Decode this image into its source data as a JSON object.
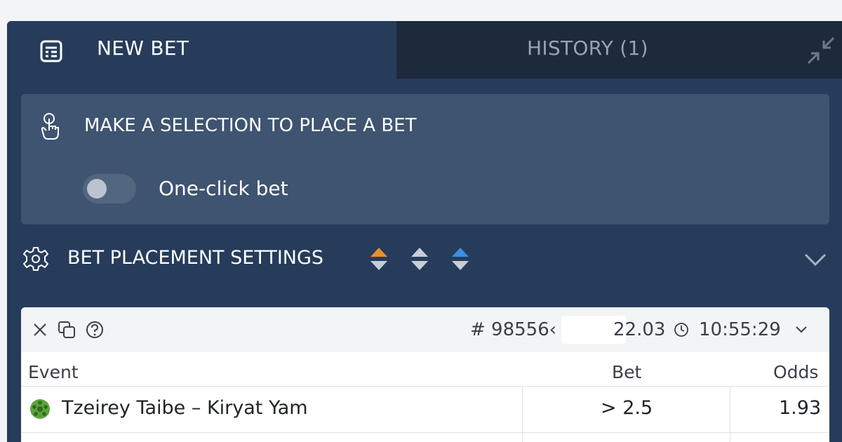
{
  "tabs": {
    "new_bet": "NEW BET",
    "history": "HISTORY (1)"
  },
  "selection": {
    "message": "MAKE A SELECTION TO PLACE A BET",
    "one_click_label": "One-click bet",
    "one_click_enabled": false
  },
  "settings": {
    "label": "BET PLACEMENT SETTINGS",
    "odds_arrow_colors": [
      "#e8912a",
      "#c7ced8",
      "#3b8ede"
    ]
  },
  "bet": {
    "id": "# 98556‹",
    "date": "22.03",
    "time": "10:55:29",
    "columns": {
      "event": "Event",
      "bet": "Bet",
      "odds": "Odds"
    },
    "rows": [
      {
        "event": "Tzeirey Taibe – Kiryat Yam",
        "bet": "> 2.5",
        "odds": "1.93"
      }
    ]
  },
  "colors": {
    "panel": "#263c5a",
    "history_tab": "#1c2a3c",
    "selection_box": "#3e5470"
  }
}
